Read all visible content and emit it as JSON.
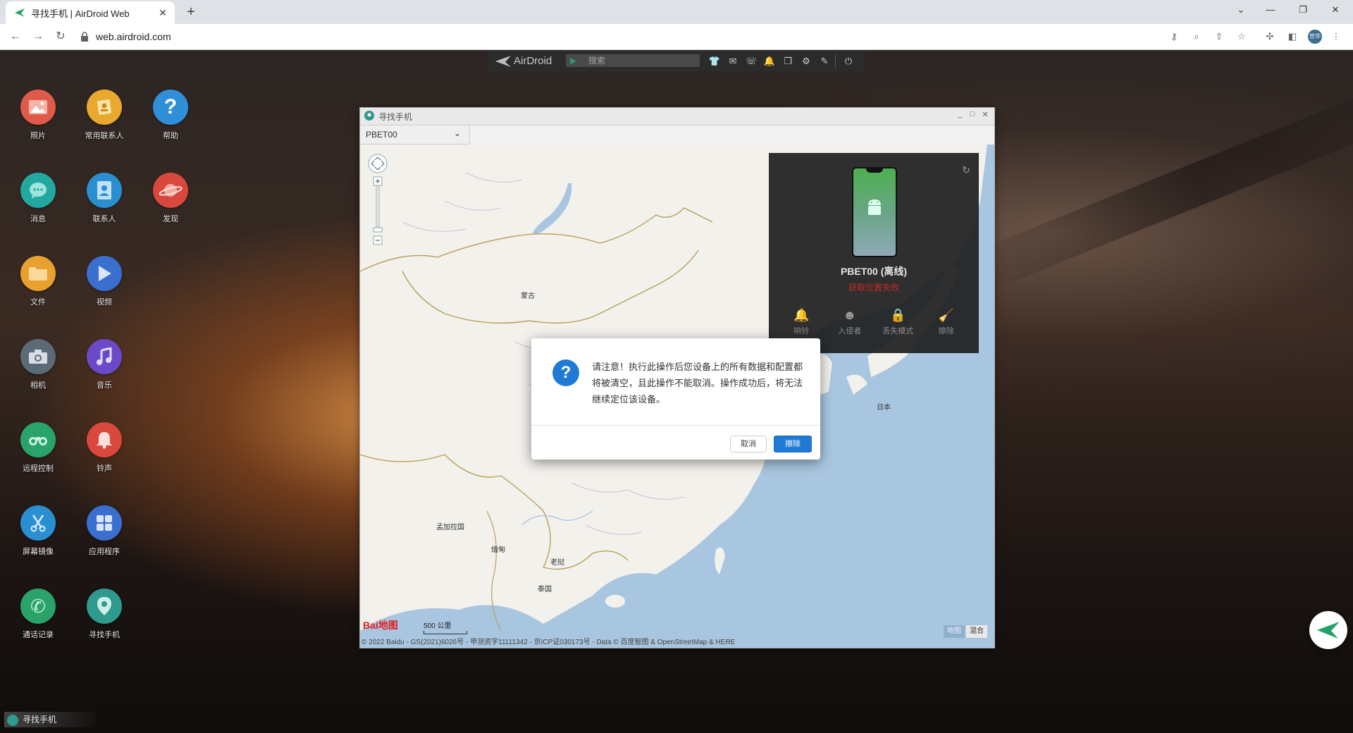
{
  "browser": {
    "tab_title": "寻找手机 | AirDroid Web",
    "tab_close": "✕",
    "new_tab": "+",
    "url": "web.airdroid.com",
    "profile_initials": "世华"
  },
  "airdroid_bar": {
    "logo": "AirDroid",
    "search_placeholder": "搜索"
  },
  "apps": [
    {
      "label": "照片"
    },
    {
      "label": "常用联系人"
    },
    {
      "label": "帮助"
    },
    {
      "label": "消息"
    },
    {
      "label": "联系人"
    },
    {
      "label": "发现"
    },
    {
      "label": "文件"
    },
    {
      "label": "视频"
    },
    {
      "label": "相机"
    },
    {
      "label": "音乐"
    },
    {
      "label": "远程控制"
    },
    {
      "label": "铃声"
    },
    {
      "label": "屏幕镜像"
    },
    {
      "label": "应用程序"
    },
    {
      "label": "通话记录"
    },
    {
      "label": "寻找手机"
    }
  ],
  "window": {
    "title": "寻找手机",
    "device_select": "PBET00"
  },
  "map": {
    "labels": {
      "mongolia": "蒙古",
      "japan": "日本",
      "bangladesh": "孟加拉国",
      "myanmar": "缅甸",
      "laos": "老挝",
      "thailand": "泰国"
    },
    "scale": "500 公里",
    "baidu": "Bai地图",
    "copyright": "© 2022 Baidu - GS(2021)6026号 - 甲测资字11111342 - 京ICP证030173号 - Data © 百度智图 & OpenStreetMap & HERE",
    "type_map": "地图",
    "type_hybrid": "混合"
  },
  "device_panel": {
    "name": "PBET00 (离线)",
    "status": "获取位置失败",
    "actions": [
      "响铃",
      "入侵者",
      "丢失模式",
      "擦除"
    ]
  },
  "dialog": {
    "message": "请注意！执行此操作后您设备上的所有数据和配置都将被清空，且此操作不能取消。操作成功后，将无法继续定位该设备。",
    "cancel": "取消",
    "confirm": "擦除"
  },
  "taskbar": {
    "item": "寻找手机"
  },
  "colors": {
    "accent": "#1f7ad6",
    "error": "#c62828"
  }
}
